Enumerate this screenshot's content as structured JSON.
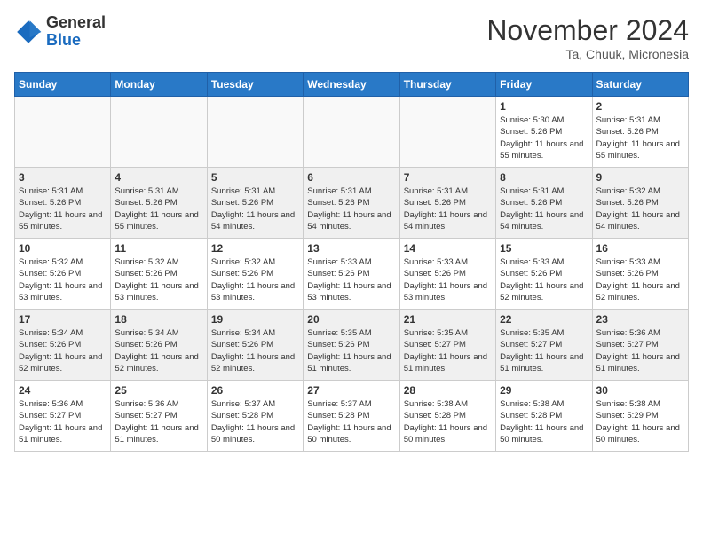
{
  "header": {
    "logo_line1": "General",
    "logo_line2": "Blue",
    "month_title": "November 2024",
    "location": "Ta, Chuuk, Micronesia"
  },
  "weekdays": [
    "Sunday",
    "Monday",
    "Tuesday",
    "Wednesday",
    "Thursday",
    "Friday",
    "Saturday"
  ],
  "weeks": [
    [
      {
        "day": "",
        "info": ""
      },
      {
        "day": "",
        "info": ""
      },
      {
        "day": "",
        "info": ""
      },
      {
        "day": "",
        "info": ""
      },
      {
        "day": "",
        "info": ""
      },
      {
        "day": "1",
        "info": "Sunrise: 5:30 AM\nSunset: 5:26 PM\nDaylight: 11 hours and 55 minutes."
      },
      {
        "day": "2",
        "info": "Sunrise: 5:31 AM\nSunset: 5:26 PM\nDaylight: 11 hours and 55 minutes."
      }
    ],
    [
      {
        "day": "3",
        "info": "Sunrise: 5:31 AM\nSunset: 5:26 PM\nDaylight: 11 hours and 55 minutes."
      },
      {
        "day": "4",
        "info": "Sunrise: 5:31 AM\nSunset: 5:26 PM\nDaylight: 11 hours and 55 minutes."
      },
      {
        "day": "5",
        "info": "Sunrise: 5:31 AM\nSunset: 5:26 PM\nDaylight: 11 hours and 54 minutes."
      },
      {
        "day": "6",
        "info": "Sunrise: 5:31 AM\nSunset: 5:26 PM\nDaylight: 11 hours and 54 minutes."
      },
      {
        "day": "7",
        "info": "Sunrise: 5:31 AM\nSunset: 5:26 PM\nDaylight: 11 hours and 54 minutes."
      },
      {
        "day": "8",
        "info": "Sunrise: 5:31 AM\nSunset: 5:26 PM\nDaylight: 11 hours and 54 minutes."
      },
      {
        "day": "9",
        "info": "Sunrise: 5:32 AM\nSunset: 5:26 PM\nDaylight: 11 hours and 54 minutes."
      }
    ],
    [
      {
        "day": "10",
        "info": "Sunrise: 5:32 AM\nSunset: 5:26 PM\nDaylight: 11 hours and 53 minutes."
      },
      {
        "day": "11",
        "info": "Sunrise: 5:32 AM\nSunset: 5:26 PM\nDaylight: 11 hours and 53 minutes."
      },
      {
        "day": "12",
        "info": "Sunrise: 5:32 AM\nSunset: 5:26 PM\nDaylight: 11 hours and 53 minutes."
      },
      {
        "day": "13",
        "info": "Sunrise: 5:33 AM\nSunset: 5:26 PM\nDaylight: 11 hours and 53 minutes."
      },
      {
        "day": "14",
        "info": "Sunrise: 5:33 AM\nSunset: 5:26 PM\nDaylight: 11 hours and 53 minutes."
      },
      {
        "day": "15",
        "info": "Sunrise: 5:33 AM\nSunset: 5:26 PM\nDaylight: 11 hours and 52 minutes."
      },
      {
        "day": "16",
        "info": "Sunrise: 5:33 AM\nSunset: 5:26 PM\nDaylight: 11 hours and 52 minutes."
      }
    ],
    [
      {
        "day": "17",
        "info": "Sunrise: 5:34 AM\nSunset: 5:26 PM\nDaylight: 11 hours and 52 minutes."
      },
      {
        "day": "18",
        "info": "Sunrise: 5:34 AM\nSunset: 5:26 PM\nDaylight: 11 hours and 52 minutes."
      },
      {
        "day": "19",
        "info": "Sunrise: 5:34 AM\nSunset: 5:26 PM\nDaylight: 11 hours and 52 minutes."
      },
      {
        "day": "20",
        "info": "Sunrise: 5:35 AM\nSunset: 5:26 PM\nDaylight: 11 hours and 51 minutes."
      },
      {
        "day": "21",
        "info": "Sunrise: 5:35 AM\nSunset: 5:27 PM\nDaylight: 11 hours and 51 minutes."
      },
      {
        "day": "22",
        "info": "Sunrise: 5:35 AM\nSunset: 5:27 PM\nDaylight: 11 hours and 51 minutes."
      },
      {
        "day": "23",
        "info": "Sunrise: 5:36 AM\nSunset: 5:27 PM\nDaylight: 11 hours and 51 minutes."
      }
    ],
    [
      {
        "day": "24",
        "info": "Sunrise: 5:36 AM\nSunset: 5:27 PM\nDaylight: 11 hours and 51 minutes."
      },
      {
        "day": "25",
        "info": "Sunrise: 5:36 AM\nSunset: 5:27 PM\nDaylight: 11 hours and 51 minutes."
      },
      {
        "day": "26",
        "info": "Sunrise: 5:37 AM\nSunset: 5:28 PM\nDaylight: 11 hours and 50 minutes."
      },
      {
        "day": "27",
        "info": "Sunrise: 5:37 AM\nSunset: 5:28 PM\nDaylight: 11 hours and 50 minutes."
      },
      {
        "day": "28",
        "info": "Sunrise: 5:38 AM\nSunset: 5:28 PM\nDaylight: 11 hours and 50 minutes."
      },
      {
        "day": "29",
        "info": "Sunrise: 5:38 AM\nSunset: 5:28 PM\nDaylight: 11 hours and 50 minutes."
      },
      {
        "day": "30",
        "info": "Sunrise: 5:38 AM\nSunset: 5:29 PM\nDaylight: 11 hours and 50 minutes."
      }
    ]
  ]
}
